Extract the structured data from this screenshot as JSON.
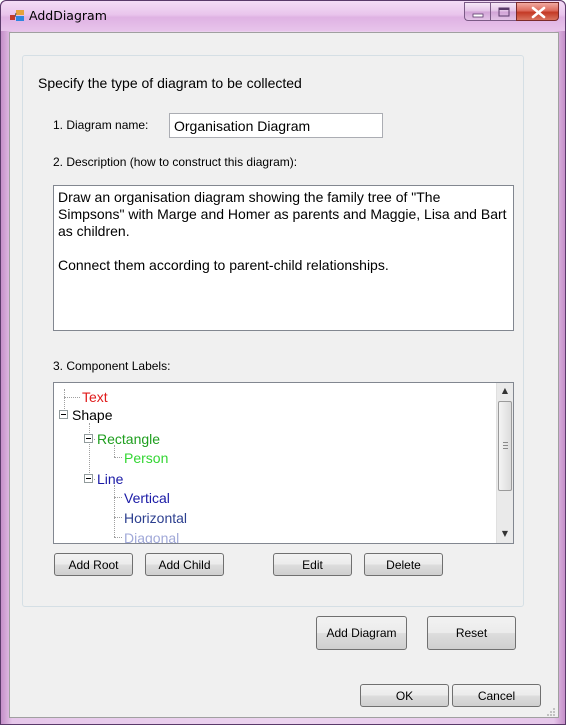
{
  "window": {
    "title": "AddDiagram",
    "minimize_icon": "minimize-icon",
    "maximize_icon": "maximize-icon",
    "close_icon": "close-icon"
  },
  "group": {
    "title": "Specify the type of diagram to be collected"
  },
  "fields": {
    "name_label": "1. Diagram name:",
    "name_value": "Organisation Diagram",
    "description_label": "2. Description (how to construct this diagram):",
    "description_value": "Draw an organisation diagram showing the family tree of \"The Simpsons\" with Marge and Homer as parents and Maggie, Lisa and Bart as children.\n\nConnect them according to parent-child relationships.",
    "components_label": "3. Component Labels:"
  },
  "tree": [
    {
      "label": "Text",
      "color": "#e01b1b"
    },
    {
      "label": "Shape",
      "color": "#000000"
    },
    {
      "label": "Rectangle",
      "color": "#1e9e1e"
    },
    {
      "label": "Person",
      "color": "#33d633"
    },
    {
      "label": "Line",
      "color": "#1a1aa6"
    },
    {
      "label": "Vertical",
      "color": "#1a1aa6"
    },
    {
      "label": "Horizontal",
      "color": "#2c3f8f"
    },
    {
      "label": "Diagonal",
      "color": "#a0a8d8"
    }
  ],
  "buttons": {
    "add_root": "Add Root",
    "add_child": "Add Child",
    "edit": "Edit",
    "delete": "Delete",
    "add_diagram": "Add Diagram",
    "reset": "Reset",
    "ok": "OK",
    "cancel": "Cancel"
  }
}
